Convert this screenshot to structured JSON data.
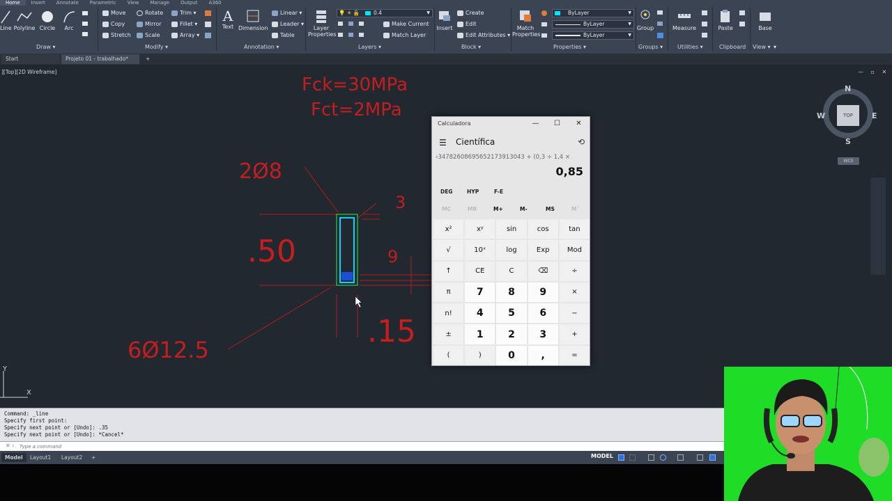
{
  "ribbon": {
    "tabs": [
      "Home",
      "Insert",
      "Annotate",
      "Parametric",
      "View",
      "Manage",
      "Output",
      "A360"
    ],
    "draw": {
      "line": "Line",
      "polyline": "Polyline",
      "circle": "Circle",
      "arc": "Arc",
      "panel": "Draw ▾"
    },
    "modify": {
      "move": "Move",
      "rotate": "Rotate",
      "trim": "Trim ▾",
      "copy": "Copy",
      "mirror": "Mirror",
      "fillet": "Fillet ▾",
      "stretch": "Stretch",
      "scale": "Scale",
      "array": "Array ▾",
      "panel": "Modify ▾"
    },
    "annotation": {
      "text": "Text",
      "dimension": "Dimension",
      "linear": "Linear ▾",
      "leader": "Leader ▾",
      "table": "Table",
      "panel": "Annotation ▾"
    },
    "layers": {
      "layer_properties": "Layer\nProperties",
      "current_layer": "0.4",
      "make_current": "Make Current",
      "match_layer": "Match Layer",
      "panel": "Layers ▾"
    },
    "block": {
      "insert": "Insert",
      "create": "Create",
      "edit": "Edit",
      "edit_attributes": "Edit Attributes ▾",
      "panel": "Block ▾"
    },
    "properties": {
      "match_properties": "Match\nProperties",
      "color": "ByLayer",
      "linetype": "ByLayer",
      "lineweight": "ByLayer",
      "panel": "Properties ▾"
    },
    "groups": {
      "group": "Group",
      "panel": "Groups ▾"
    },
    "utilities": {
      "measure": "Measure",
      "panel": "Utilities ▾"
    },
    "clipboard": {
      "paste": "Paste",
      "panel": "Clipboard"
    },
    "view": {
      "base": "Base",
      "panel": "View ▾"
    },
    "layer_color": "#00e5ff"
  },
  "file_tabs": {
    "start": "Start",
    "project": "Projeto 01 - trabalhado*",
    "plus": "+"
  },
  "canvas": {
    "viewport_label": "][Top][2D Wireframe]",
    "annotations": {
      "fck": "Fck=30MPa",
      "fct": "Fct=2MPa",
      "top_bars": "2Ø8",
      "stirrup_label": "3",
      "height": ".50",
      "cover": "9",
      "width": ".15",
      "bottom_bars": "6Ø12.5"
    },
    "annotation_color": "#c41e1e",
    "viewcube": {
      "n": "N",
      "s": "S",
      "e": "E",
      "w": "W",
      "face": "TOP",
      "wcs": "WCS"
    },
    "ucs": {
      "x": "X",
      "y": "Y"
    }
  },
  "calculator": {
    "title": "Calculadora",
    "mode": "Científica",
    "expression": "34782608695652173913043 + (0,3 ÷ 1,4 ×",
    "display": "0,85",
    "angle_buttons": [
      "DEG",
      "HYP",
      "F-E"
    ],
    "memory_buttons": [
      "MC",
      "MR",
      "M+",
      "M-",
      "MS",
      "M˅"
    ],
    "keys": [
      [
        "x²",
        "xʸ",
        "sin",
        "cos",
        "tan"
      ],
      [
        "√",
        "10ˣ",
        "log",
        "Exp",
        "Mod"
      ],
      [
        "↑",
        "CE",
        "C",
        "⌫",
        "÷"
      ],
      [
        "π",
        "7",
        "8",
        "9",
        "×"
      ],
      [
        "n!",
        "4",
        "5",
        "6",
        "−"
      ],
      [
        "±",
        "1",
        "2",
        "3",
        "+"
      ],
      [
        "(",
        ")",
        "0",
        ",",
        "="
      ]
    ]
  },
  "command_line": {
    "history": [
      "Command: _line",
      "Specify first point:",
      "Specify next point or [Undo]: .35",
      "Specify next point or [Undo]: *Cancel*"
    ],
    "placeholder": "Type a command"
  },
  "status_bar": {
    "layouts": [
      "Model",
      "Layout1",
      "Layout2",
      "+"
    ],
    "model_button": "MODEL"
  }
}
